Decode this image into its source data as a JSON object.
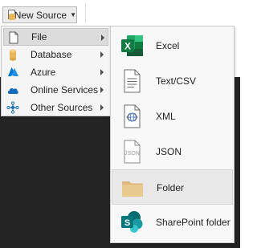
{
  "toolbar": {
    "new_source_label": "New Source"
  },
  "menu": {
    "items": [
      {
        "label": "File",
        "icon": "file-icon",
        "has_submenu": true,
        "selected": true
      },
      {
        "label": "Database",
        "icon": "database-icon",
        "has_submenu": true
      },
      {
        "label": "Azure",
        "icon": "azure-icon",
        "has_submenu": true
      },
      {
        "label": "Online Services",
        "icon": "cloud-icon",
        "has_submenu": true
      },
      {
        "label": "Other Sources",
        "icon": "network-icon",
        "has_submenu": true
      }
    ]
  },
  "submenu": {
    "items": [
      {
        "label": "Excel",
        "icon": "excel-icon"
      },
      {
        "label": "Text/CSV",
        "icon": "text-csv-icon"
      },
      {
        "label": "XML",
        "icon": "xml-icon"
      },
      {
        "label": "JSON",
        "icon": "json-icon",
        "badge": "JSON"
      },
      {
        "label": "Folder",
        "icon": "folder-icon",
        "hovered": true
      },
      {
        "label": "SharePoint folder",
        "icon": "sharepoint-folder-icon"
      }
    ]
  },
  "colors": {
    "excel_green": "#1d6f42",
    "sharepoint_teal": "#038387",
    "folder_tan": "#dcb67a",
    "azure_blue": "#0078d4",
    "cloud_blue": "#0f6cbd",
    "database_gold": "#e8b85a",
    "dark_canvas": "#242424"
  }
}
